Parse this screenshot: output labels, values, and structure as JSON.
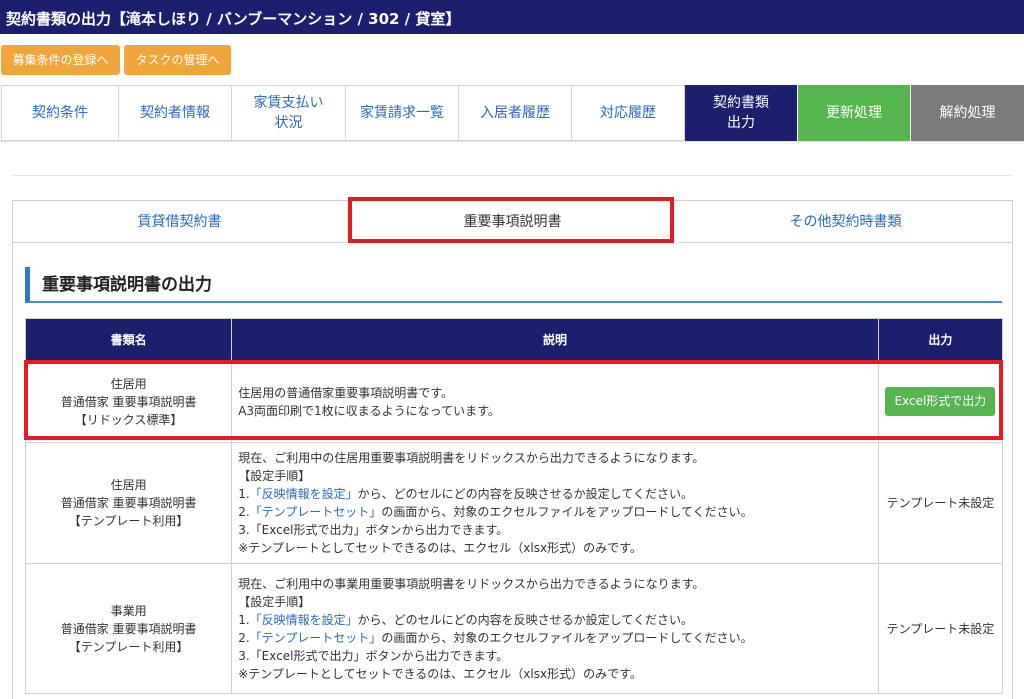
{
  "titlebar": {
    "title": "契約書類の出力【滝本しほり / バンブーマンション / 302 / 貸室】"
  },
  "top_buttons": {
    "recruit": "募集条件の登録へ",
    "task": "タスクの管理へ"
  },
  "main_tabs": [
    {
      "label": "契約条件"
    },
    {
      "label": "契約者情報"
    },
    {
      "label": "家賃支払い\n状況"
    },
    {
      "label": "家賃請求一覧"
    },
    {
      "label": "入居者履歴"
    },
    {
      "label": "対応履歴"
    },
    {
      "label": "契約書類\n出力"
    },
    {
      "label": "更新処理"
    },
    {
      "label": "解約処理"
    }
  ],
  "sub_tabs": [
    {
      "label": "賃貸借契約書"
    },
    {
      "label": "重要事項説明書"
    },
    {
      "label": "その他契約時書類"
    }
  ],
  "section": {
    "title": "重要事項説明書の出力"
  },
  "table": {
    "headers": {
      "name": "書類名",
      "desc": "説明",
      "output": "出力"
    },
    "rows": [
      {
        "name": [
          "住居用",
          "普通借家 重要事項説明書",
          "【リドックス標準】"
        ],
        "desc_lines": [
          "住居用の普通借家重要事項説明書です。",
          "A3両面印刷で1枚に収まるようになっています。"
        ],
        "output_button": "Excel形式で出力"
      },
      {
        "name": [
          "住居用",
          "普通借家 重要事項説明書",
          "【テンプレート利用】"
        ],
        "desc_intro": "現在、ご利用中の住居用重要事項説明書をリドックスから出力できるようになります。",
        "steps_label": "【設定手順】",
        "step1_prefix": "1.",
        "step1_link": "「反映情報を設定」",
        "step1_rest": "から、どのセルにどの内容を反映させるか設定してください。",
        "step2_prefix": "2.",
        "step2_link": "「テンプレートセット」",
        "step2_rest": "の画面から、対象のエクセルファイルをアップロードしてください。",
        "step3": "3.「Excel形式で出力」ボタンから出力できます。",
        "note": "※テンプレートとしてセットできるのは、エクセル（xlsx形式）のみです。",
        "output_status": "テンプレート未設定"
      },
      {
        "name": [
          "事業用",
          "普通借家 重要事項説明書",
          "【テンプレート利用】"
        ],
        "desc_intro": "現在、ご利用中の事業用重要事項説明書をリドックスから出力できるようになります。",
        "steps_label": "【設定手順】",
        "step1_prefix": "1.",
        "step1_link": "「反映情報を設定」",
        "step1_rest": "から、どのセルにどの内容を反映させるか設定してください。",
        "step2_prefix": "2.",
        "step2_link": "「テンプレートセット」",
        "step2_rest": "の画面から、対象のエクセルファイルをアップロードしてください。",
        "step3": "3.「Excel形式で出力」ボタンから出力できます。",
        "note": "※テンプレートとしてセットできるのは、エクセル（xlsx形式）のみです。",
        "output_status": "テンプレート未設定"
      }
    ]
  },
  "colors": {
    "navy": "#1c1f6e",
    "accent_blue": "#2b6ab8",
    "green": "#55b64f",
    "orange": "#f0a63c",
    "gray": "#7b7b7b",
    "highlight_red": "#e31c23"
  }
}
